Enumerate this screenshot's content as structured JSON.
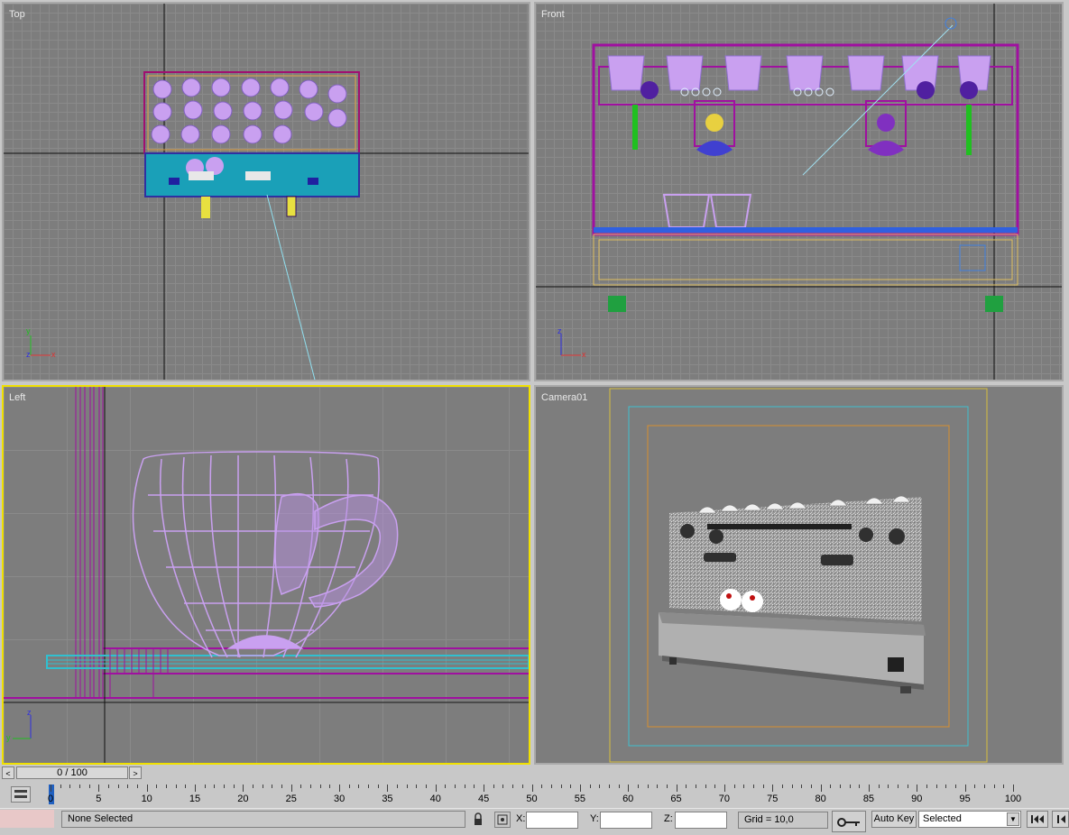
{
  "viewports": {
    "top": {
      "label": "Top"
    },
    "front": {
      "label": "Front"
    },
    "left": {
      "label": "Left"
    },
    "camera": {
      "label": "Camera01"
    }
  },
  "axes": {
    "x": "x",
    "y": "y",
    "z": "z"
  },
  "time_slider": {
    "value": "0 / 100",
    "prev": "<",
    "next": ">"
  },
  "ruler": {
    "ticks": [
      "0",
      "5",
      "10",
      "15",
      "20",
      "25",
      "30",
      "35",
      "40",
      "45",
      "50",
      "55",
      "60",
      "65",
      "70",
      "75",
      "80",
      "85",
      "90",
      "95",
      "100"
    ]
  },
  "status": {
    "selection": "None Selected",
    "x_label": "X:",
    "y_label": "Y:",
    "z_label": "Z:",
    "x_value": "",
    "y_value": "",
    "z_value": "",
    "grid": "Grid = 10,0",
    "auto_key": "Auto Key",
    "key_mode": "Selected"
  },
  "icons": {
    "lock": "lock-icon",
    "key": "key-icon",
    "crosshair": "absolute-mode-icon",
    "goto_start": "goto-start-icon"
  }
}
